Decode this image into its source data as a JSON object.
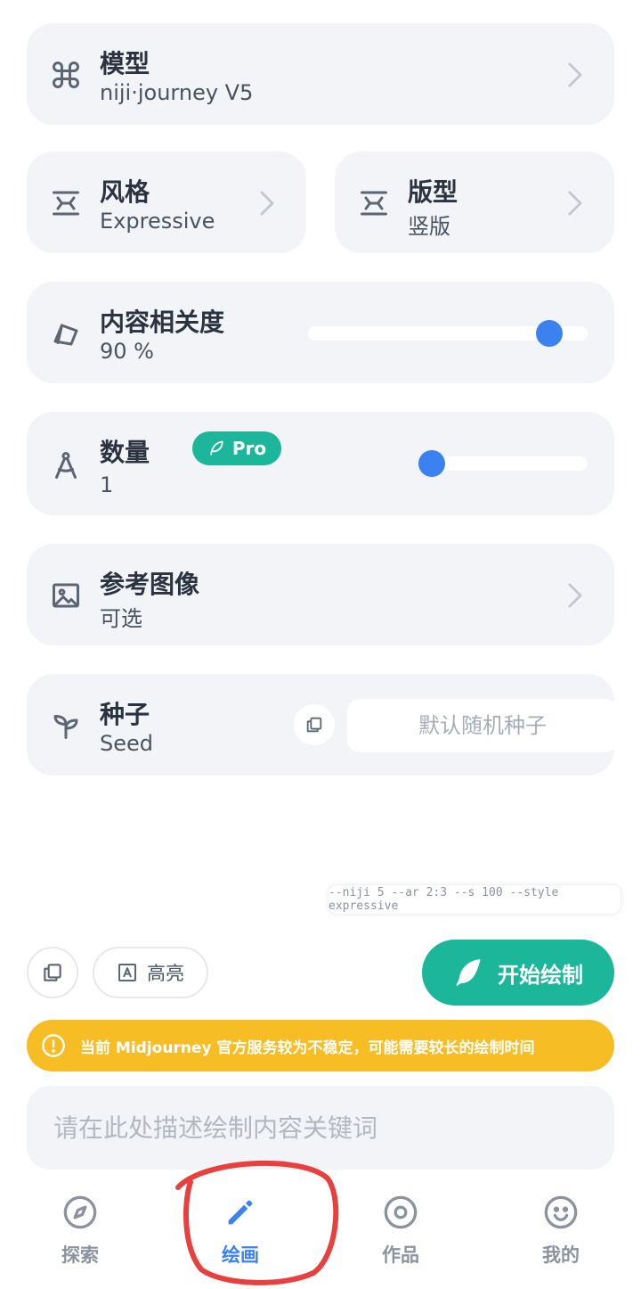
{
  "model": {
    "title": "模型",
    "value": "niji·journey V5"
  },
  "style": {
    "title": "风格",
    "value": "Expressive"
  },
  "layout": {
    "title": "版型",
    "value": "竖版"
  },
  "relevance": {
    "title": "内容相关度",
    "value": "90 %",
    "level": 0.9
  },
  "quantity": {
    "title": "数量",
    "badge": "Pro",
    "value": "1",
    "level": 0.0
  },
  "reference": {
    "title": "参考图像",
    "value": "可选"
  },
  "seed": {
    "title": "种子",
    "subtitle": "Seed",
    "placeholder": "默认随机种子"
  },
  "params_text": "--niji 5 --ar 2:3 --s 100 --style expressive",
  "actions": {
    "highlight_label": "高亮",
    "start_label": "开始绘制"
  },
  "notice": {
    "text": "当前 Midjourney 官方服务较为不稳定，可能需要较长的绘制时间"
  },
  "prompt": {
    "placeholder": "请在此处描述绘制内容关键词"
  },
  "tabs": [
    {
      "label": "探索",
      "icon": "compass-icon",
      "active": false
    },
    {
      "label": "绘画",
      "icon": "pencil-icon",
      "active": true
    },
    {
      "label": "作品",
      "icon": "target-icon",
      "active": false
    },
    {
      "label": "我的",
      "icon": "smiley-icon",
      "active": false
    }
  ],
  "colors": {
    "accent_blue": "#3b82f0",
    "accent_green": "#1cb69a",
    "notice_yellow": "#f7bd25",
    "card_bg": "#f2f4f7",
    "annotation_red": "#e8403f"
  }
}
